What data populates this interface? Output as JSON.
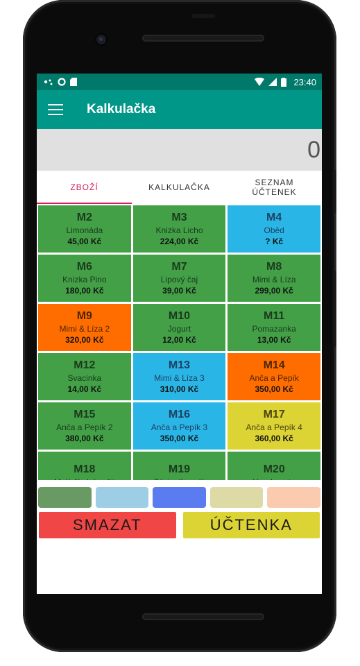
{
  "status_bar": {
    "time": "23:40",
    "icons_left": [
      "notification-dots-icon",
      "circle-icon",
      "sd-card-icon"
    ],
    "icons_right": [
      "wifi-icon",
      "signal-icon",
      "battery-icon"
    ]
  },
  "app_bar": {
    "title": "Kalkulačka"
  },
  "display": {
    "value": "0"
  },
  "tabs": [
    {
      "label": "ZBOŽÍ",
      "active": true
    },
    {
      "label": "KALKULAČKA",
      "active": false
    },
    {
      "label": "SEZNAM\nÚČTENEK",
      "active": false
    }
  ],
  "products": [
    {
      "code": "M2",
      "name": "Limonáda",
      "price": "45,00 Kč",
      "color": "green"
    },
    {
      "code": "M3",
      "name": "Knizka Licho",
      "price": "224,00 Kč",
      "color": "green"
    },
    {
      "code": "M4",
      "name": "Oběd",
      "price": "? Kč",
      "color": "blue"
    },
    {
      "code": "M6",
      "name": "Knizka Pino",
      "price": "180,00 Kč",
      "color": "green"
    },
    {
      "code": "M7",
      "name": "Lipový čaj",
      "price": "39,00 Kč",
      "color": "green"
    },
    {
      "code": "M8",
      "name": "Mimi & Líza",
      "price": "299,00 Kč",
      "color": "green"
    },
    {
      "code": "M9",
      "name": "Mimi & Líza 2",
      "price": "320,00 Kč",
      "color": "orange"
    },
    {
      "code": "M10",
      "name": "Jogurt",
      "price": "12,00 Kč",
      "color": "green"
    },
    {
      "code": "M11",
      "name": "Pomazanka",
      "price": "13,00 Kč",
      "color": "green"
    },
    {
      "code": "M12",
      "name": "Svacinka",
      "price": "14,00 Kč",
      "color": "green"
    },
    {
      "code": "M13",
      "name": "Mimi & Líza 3",
      "price": "310,00 Kč",
      "color": "blue"
    },
    {
      "code": "M14",
      "name": "Anča a Pepík",
      "price": "350,00 Kč",
      "color": "orange"
    },
    {
      "code": "M15",
      "name": "Anča a Pepík 2",
      "price": "380,00 Kč",
      "color": "green"
    },
    {
      "code": "M16",
      "name": "Anča a Pepík 3",
      "price": "350,00 Kč",
      "color": "blue"
    },
    {
      "code": "M17",
      "name": "Anča a Pepík 4",
      "price": "360,00 Kč",
      "color": "yellow"
    },
    {
      "code": "M18",
      "name": "Malý školní sešit",
      "price": "",
      "color": "green"
    },
    {
      "code": "M19",
      "name": "Zápisník malý",
      "price": "",
      "color": "green"
    },
    {
      "code": "M20",
      "name": "Hry do auta",
      "price": "",
      "color": "green"
    }
  ],
  "swatches": [
    "#6a9a64",
    "#9ecde6",
    "#5b7cf0",
    "#dedaa6",
    "#fbcbb0"
  ],
  "actions": {
    "clear": {
      "label": "SMAZAT",
      "color": "#f04646"
    },
    "receipt": {
      "label": "ÚČTENKA",
      "color": "#dcd335"
    }
  },
  "colors": {
    "status_bar": "#00796b",
    "app_bar": "#009688",
    "tab_accent": "#d81b60"
  }
}
